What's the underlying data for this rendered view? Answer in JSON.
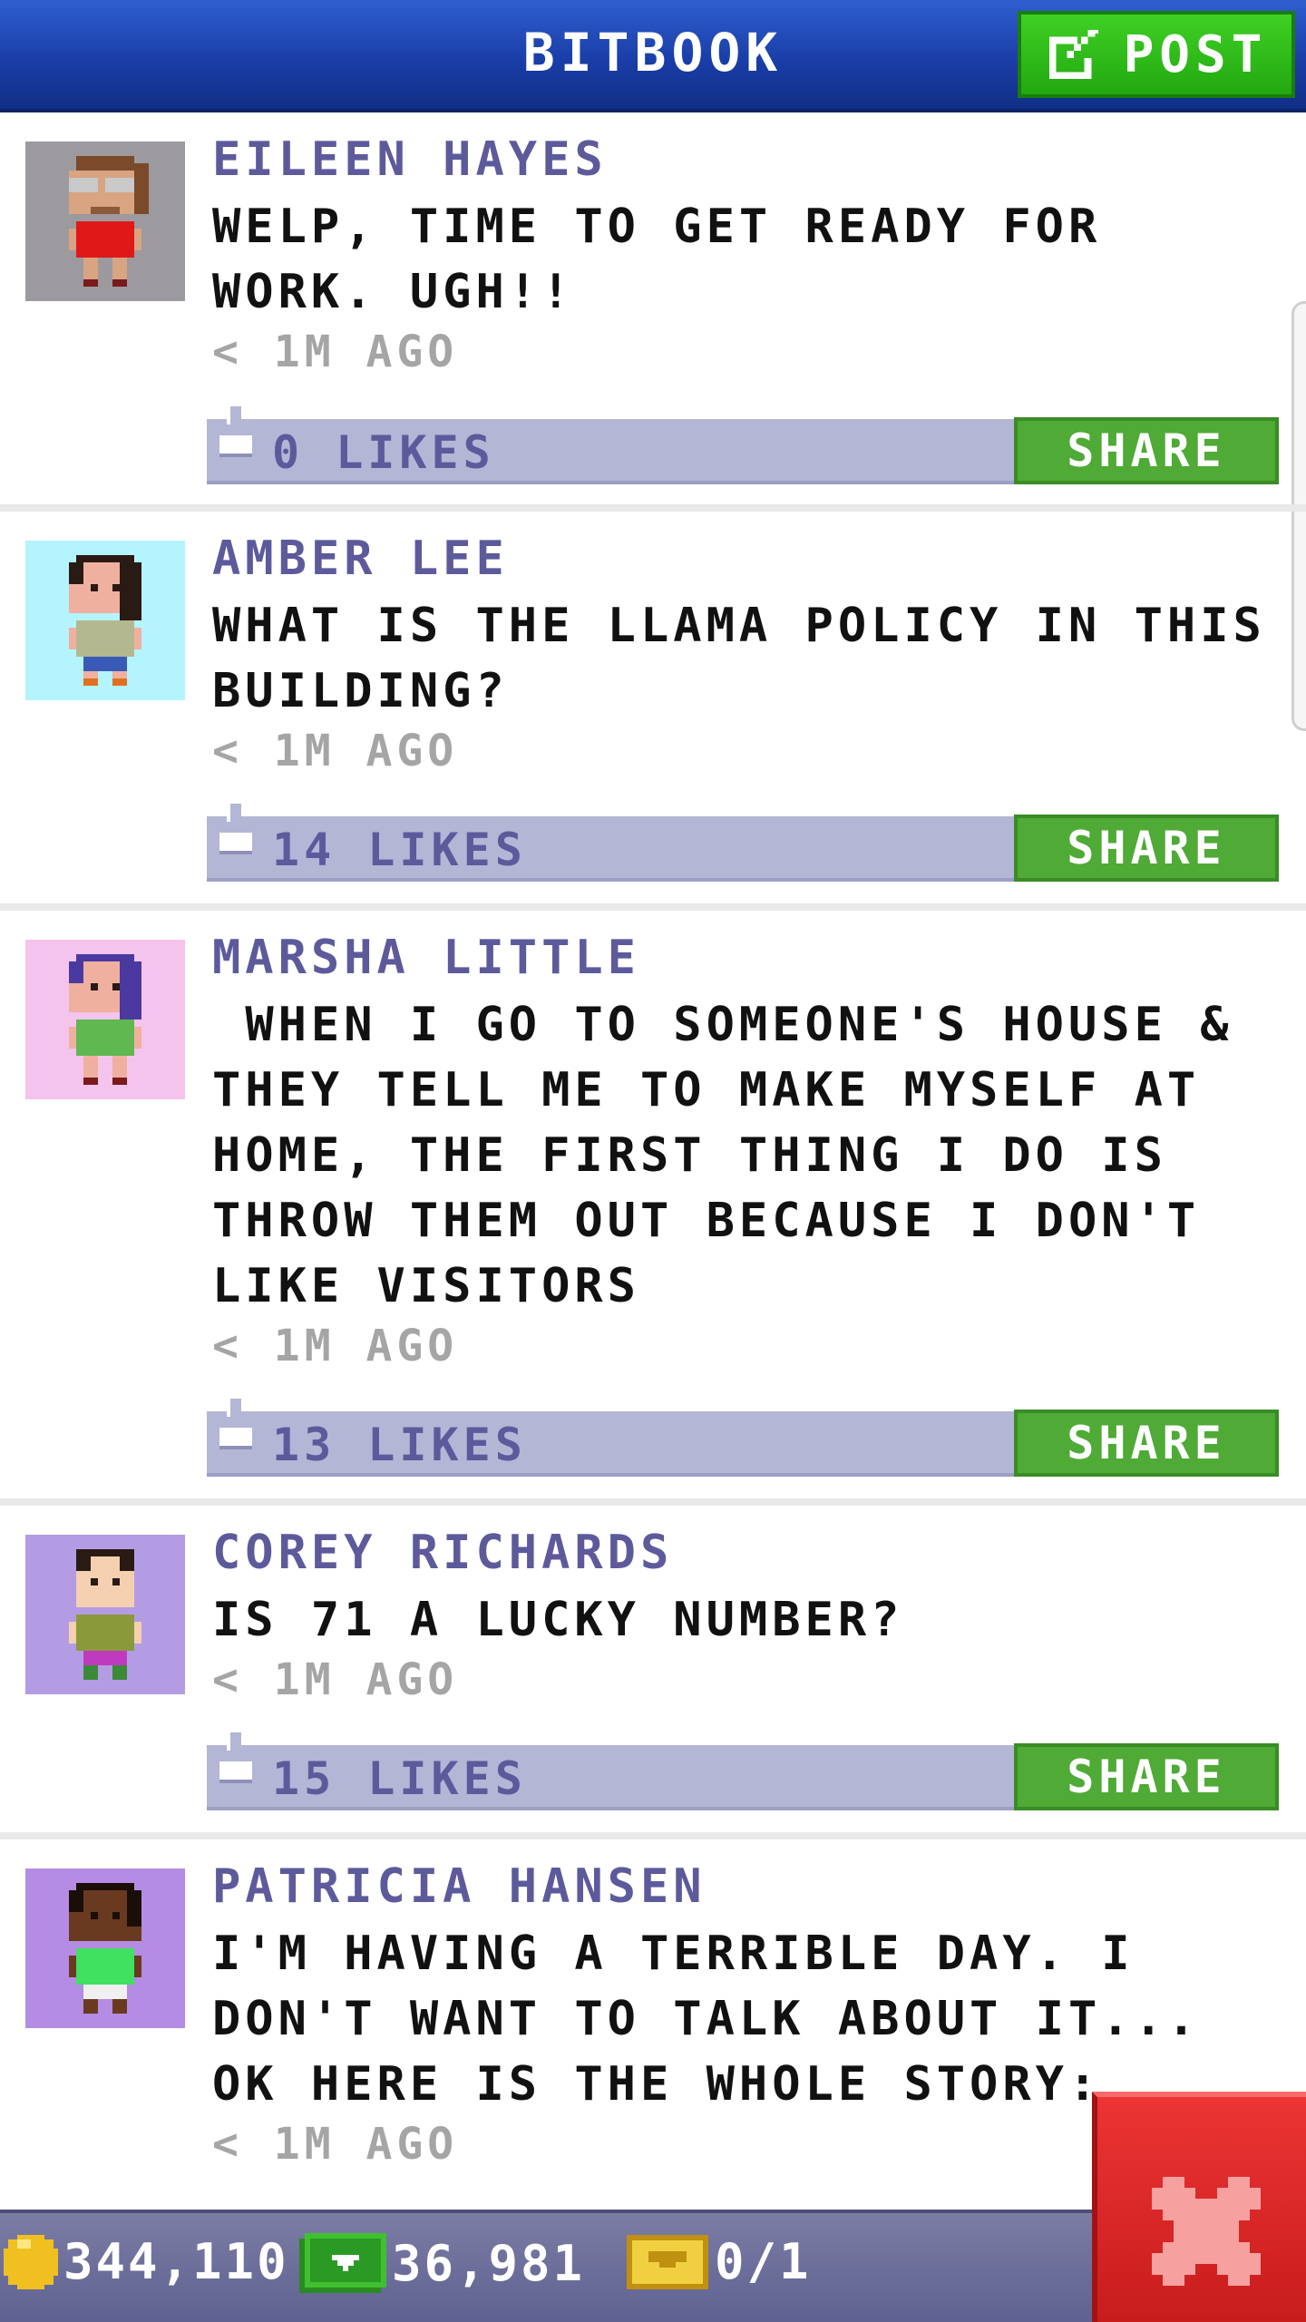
{
  "header": {
    "title": "BITBOOK",
    "post_label": "POST",
    "colors": {
      "bar": "#1a3ea8",
      "post_button": "#2bb618"
    }
  },
  "posts": [
    {
      "author": "EILEEN HAYES",
      "text": "WELP, TIME TO GET READY FOR WORK. UGH!!",
      "time": "< 1M AGO",
      "likes": "0 LIKES",
      "share_label": "SHARE",
      "avatar_bg": "#9c9a9e"
    },
    {
      "author": "AMBER LEE",
      "text": "WHAT IS THE LLAMA POLICY IN THIS BUILDING?",
      "time": "< 1M AGO",
      "likes": "14 LIKES",
      "share_label": "SHARE",
      "avatar_bg": "#b4f4ff"
    },
    {
      "author": "MARSHA LITTLE",
      "text": " WHEN I GO TO SOMEONE'S HOUSE & THEY TELL ME TO MAKE MYSELF AT HOME, THE FIRST THING I DO IS THROW THEM OUT BECAUSE I DON'T LIKE VISITORS",
      "time": "< 1M AGO",
      "likes": "13 LIKES",
      "share_label": "SHARE",
      "avatar_bg": "#f4c4ec"
    },
    {
      "author": "COREY RICHARDS",
      "text": "IS 71 A LUCKY NUMBER?",
      "time": "< 1M AGO",
      "likes": "15 LIKES",
      "share_label": "SHARE",
      "avatar_bg": "#b49ce4"
    },
    {
      "author": "PATRICIA HANSEN",
      "text": "I'M HAVING A TERRIBLE DAY. I DON'T WANT TO TALK ABOUT IT...  OK HERE IS THE WHOLE STORY:",
      "time": "< 1M AGO",
      "avatar_bg": "#b48ce4"
    }
  ],
  "status": {
    "coins": "344,110",
    "bux": "36,981",
    "vip": "0/1"
  },
  "icons": [
    "edit-icon",
    "like-icon",
    "coin-icon",
    "bux-icon",
    "vip-ticket-icon",
    "close-x-icon"
  ]
}
